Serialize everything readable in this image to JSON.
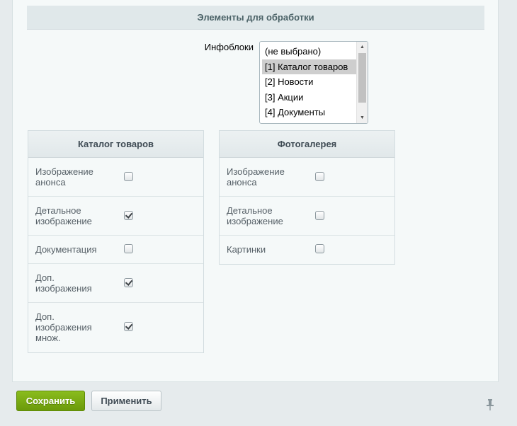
{
  "section": {
    "title": "Элементы для обработки"
  },
  "iblocks": {
    "label": "Инфоблоки",
    "options": [
      "(не выбрано)",
      "[1] Каталог товаров",
      "[2] Новости",
      "[3] Акции",
      "[4] Документы"
    ],
    "selected": "[1] Каталог товаров"
  },
  "catalog": {
    "title": "Каталог товаров",
    "rows": [
      {
        "label": "Изображение анонса",
        "checked": false
      },
      {
        "label": "Детальное изображение",
        "checked": true
      },
      {
        "label": "Документация",
        "checked": false
      },
      {
        "label": "Доп. изображения",
        "checked": true
      },
      {
        "label": "Доп. изображения множ.",
        "checked": true
      }
    ]
  },
  "gallery": {
    "title": "Фотогалерея",
    "rows": [
      {
        "label": "Изображение анонса",
        "checked": false
      },
      {
        "label": "Детальное изображение",
        "checked": false
      },
      {
        "label": "Картинки",
        "checked": false
      }
    ]
  },
  "buttons": {
    "save": "Сохранить",
    "apply": "Применить"
  },
  "icons": {
    "pin": "pin-icon",
    "scroll_up": "arrow-up-icon",
    "scroll_down": "arrow-down-icon"
  }
}
